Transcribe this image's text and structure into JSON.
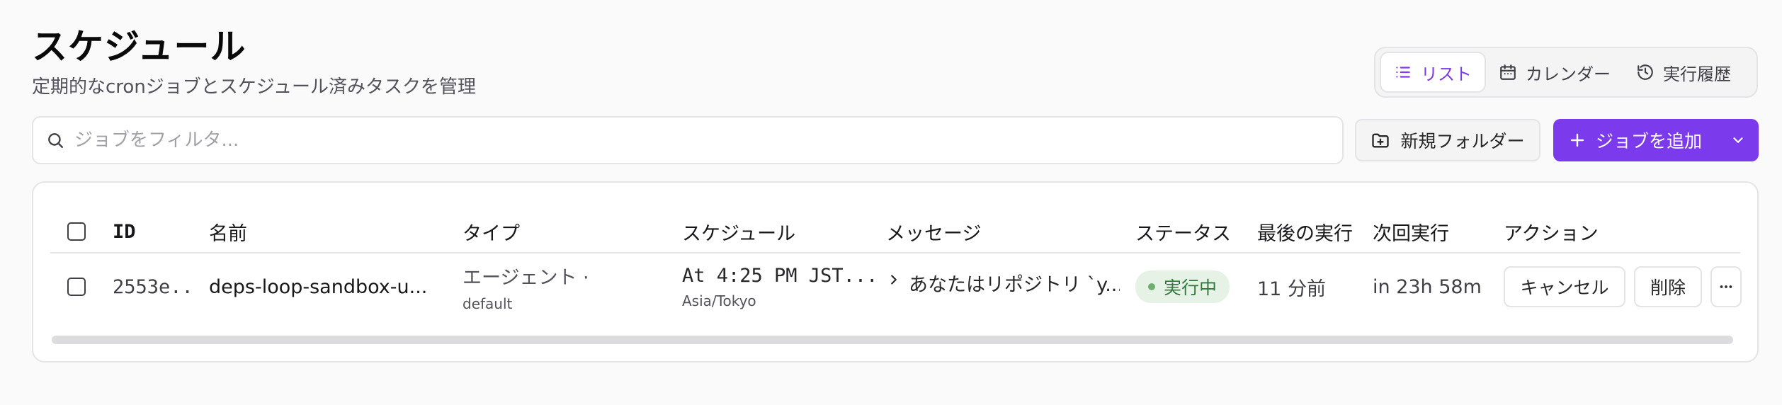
{
  "header": {
    "title": "スケジュール",
    "subtitle": "定期的なcronジョブとスケジュール済みタスクを管理"
  },
  "view_switch": {
    "list": "リスト",
    "calendar": "カレンダー",
    "history": "実行履歴"
  },
  "toolbar": {
    "search_placeholder": "ジョブをフィルタ...",
    "new_folder": "新規フォルダー",
    "add_job": "ジョブを追加"
  },
  "table": {
    "columns": [
      "ID",
      "名前",
      "タイプ",
      "スケジュール",
      "メッセージ",
      "ステータス",
      "最後の実行",
      "次回実行",
      "アクション"
    ],
    "rows": [
      {
        "id": "2553e...",
        "name": "deps-loop-sandbox-u...",
        "type": "エージェント ·",
        "type_sub": "default",
        "schedule": "At 4:25 PM JST...",
        "schedule_sub": "Asia/Tokyo",
        "message": "あなたはリポジトリ `y...",
        "status": "実行中",
        "last_run": "11 分前",
        "next_run": "in 23h 58m",
        "actions": {
          "cancel": "キャンセル",
          "delete": "削除",
          "more": "···"
        }
      }
    ]
  },
  "colors": {
    "accent": "#7c3aed",
    "status_running_bg": "#e6f2e6",
    "status_running_text": "#2f7a3a"
  }
}
